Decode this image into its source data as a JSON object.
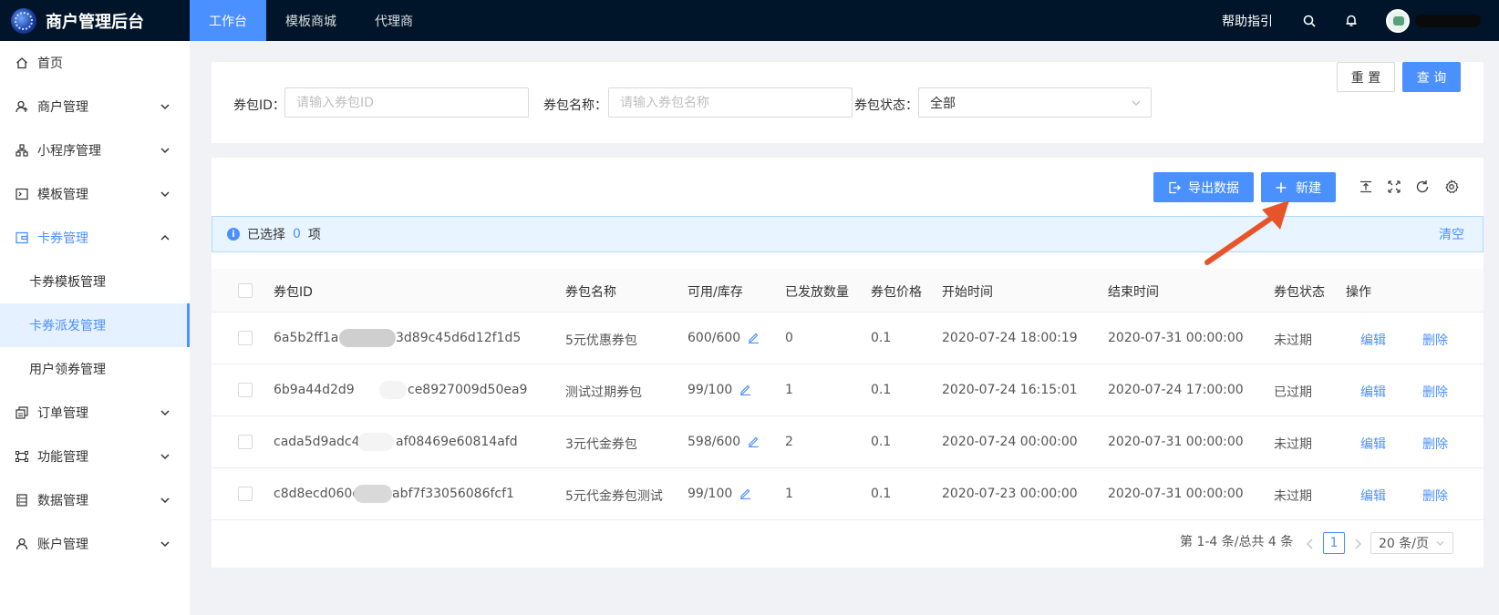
{
  "app": {
    "title": "商户管理后台"
  },
  "top_nav": [
    {
      "label": "工作台",
      "active": true
    },
    {
      "label": "模板商城",
      "active": false
    },
    {
      "label": "代理商",
      "active": false
    }
  ],
  "top_right": {
    "help": "帮助指引"
  },
  "sidebar": {
    "items": [
      {
        "label": "首页",
        "icon": "home-icon"
      },
      {
        "label": "商户管理",
        "icon": "user-icon"
      },
      {
        "label": "小程序管理",
        "icon": "cluster-icon"
      },
      {
        "label": "模板管理",
        "icon": "code-icon"
      },
      {
        "label": "卡券管理",
        "icon": "wallet-icon",
        "open": true
      },
      {
        "label": "订单管理",
        "icon": "order-icon"
      },
      {
        "label": "功能管理",
        "icon": "function-icon"
      },
      {
        "label": "数据管理",
        "icon": "database-icon"
      },
      {
        "label": "账户管理",
        "icon": "account-icon"
      }
    ],
    "sub_items": [
      {
        "label": "卡券模板管理",
        "active": false
      },
      {
        "label": "卡券派发管理",
        "active": true
      },
      {
        "label": "用户领券管理",
        "active": false
      }
    ]
  },
  "filter": {
    "id_label": "券包ID：",
    "id_placeholder": "请输入券包ID",
    "name_label": "券包名称：",
    "name_placeholder": "请输入券包名称",
    "status_label": "券包状态：",
    "status_value": "全部",
    "reset": "重 置",
    "query": "查 询"
  },
  "toolbar": {
    "export": "导出数据",
    "create": "新建"
  },
  "alert": {
    "prefix": "已选择",
    "count": "0",
    "suffix": "项",
    "clear": "清空"
  },
  "table": {
    "headers": [
      "券包ID",
      "券包名称",
      "可用/库存",
      "已发放数量",
      "券包价格",
      "开始时间",
      "结束时间",
      "券包状态",
      "操作"
    ],
    "rows": [
      {
        "id_a": "6a5b2ff1a",
        "id_b": "3d89c45d6d12f1d5",
        "name": "5元优惠券包",
        "stock": "600/600",
        "issued": "0",
        "price": "0.1",
        "start": "2020-07-24 18:00:19",
        "end": "2020-07-31 00:00:00",
        "status": "未过期",
        "edit": "编辑",
        "delete": "删除"
      },
      {
        "id_a": "6b9a44d2d9",
        "id_b": "ce8927009d50ea9",
        "name": "测试过期券包",
        "stock": "99/100",
        "issued": "1",
        "price": "0.1",
        "start": "2020-07-24 16:15:01",
        "end": "2020-07-24 17:00:00",
        "status": "已过期",
        "edit": "编辑",
        "delete": "删除"
      },
      {
        "id_a": "cada5d9adc4",
        "id_b": "af08469e60814afd",
        "name": "3元代金券包",
        "stock": "598/600",
        "issued": "2",
        "price": "0.1",
        "start": "2020-07-24 00:00:00",
        "end": "2020-07-31 00:00:00",
        "status": "未过期",
        "edit": "编辑",
        "delete": "删除"
      },
      {
        "id_a": "c8d8ecd060e",
        "id_b": "abf7f33056086fcf1",
        "name": "5元代金券包测试",
        "stock": "99/100",
        "issued": "1",
        "price": "0.1",
        "start": "2020-07-23 00:00:00",
        "end": "2020-07-31 00:00:00",
        "status": "未过期",
        "edit": "编辑",
        "delete": "删除"
      }
    ]
  },
  "pagination": {
    "summary": "第 1-4 条/总共 4 条",
    "current": "1",
    "page_size": "20 条/页"
  },
  "colors": {
    "primary": "#4a90ff",
    "topbar": "#001529",
    "arrow": "#e8542a"
  }
}
